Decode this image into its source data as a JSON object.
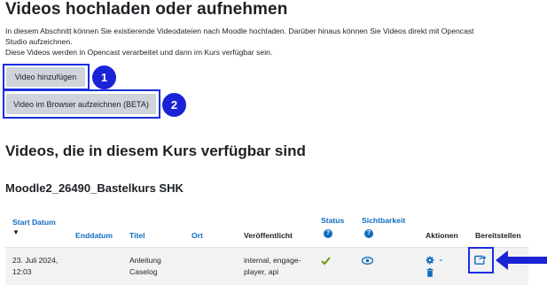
{
  "upload": {
    "title": "Videos hochladen oder aufnehmen",
    "intro_line1": "In diesem Abschnitt können Sie existierende Videodateien nach Moodle hochladen. Darüber hinaus können Sie Videos direkt mit Opencast",
    "intro_line2": "Studio aufzeichnen.",
    "intro_line3": "Diese Videos werden in Opencast verarbeitet und dann im Kurs verfügbar sein.",
    "add_video_label": "Video hinzufügen",
    "record_video_label": "Video im Browser aufzeichnen (BETA)",
    "marker_1": "1",
    "marker_2": "2"
  },
  "available": {
    "title": "Videos, die in diesem Kurs verfügbar sind",
    "course_title": "Moodle2_26490_Bastelkurs SHK"
  },
  "table": {
    "headers": {
      "start_date": "Start Datum",
      "end_date": "Enddatum",
      "title": "Titel",
      "location": "Ort",
      "published": "Veröffentlicht",
      "status": "Status",
      "visibility": "Sichtbarkeit",
      "actions": "Aktionen",
      "provide": "Bereitstellen"
    },
    "rows": [
      {
        "start_date_line1": "23. Juli 2024,",
        "start_date_line2": "12:03",
        "title_line1": "Anleitung",
        "title_line2": "Caselog",
        "published_line1": "internal, engage-",
        "published_line2": "player, api"
      }
    ]
  },
  "colors": {
    "link": "#0f6cbf",
    "highlight": "#1a2ee0",
    "success": "#6a9a1f",
    "button": "#ced4da"
  }
}
